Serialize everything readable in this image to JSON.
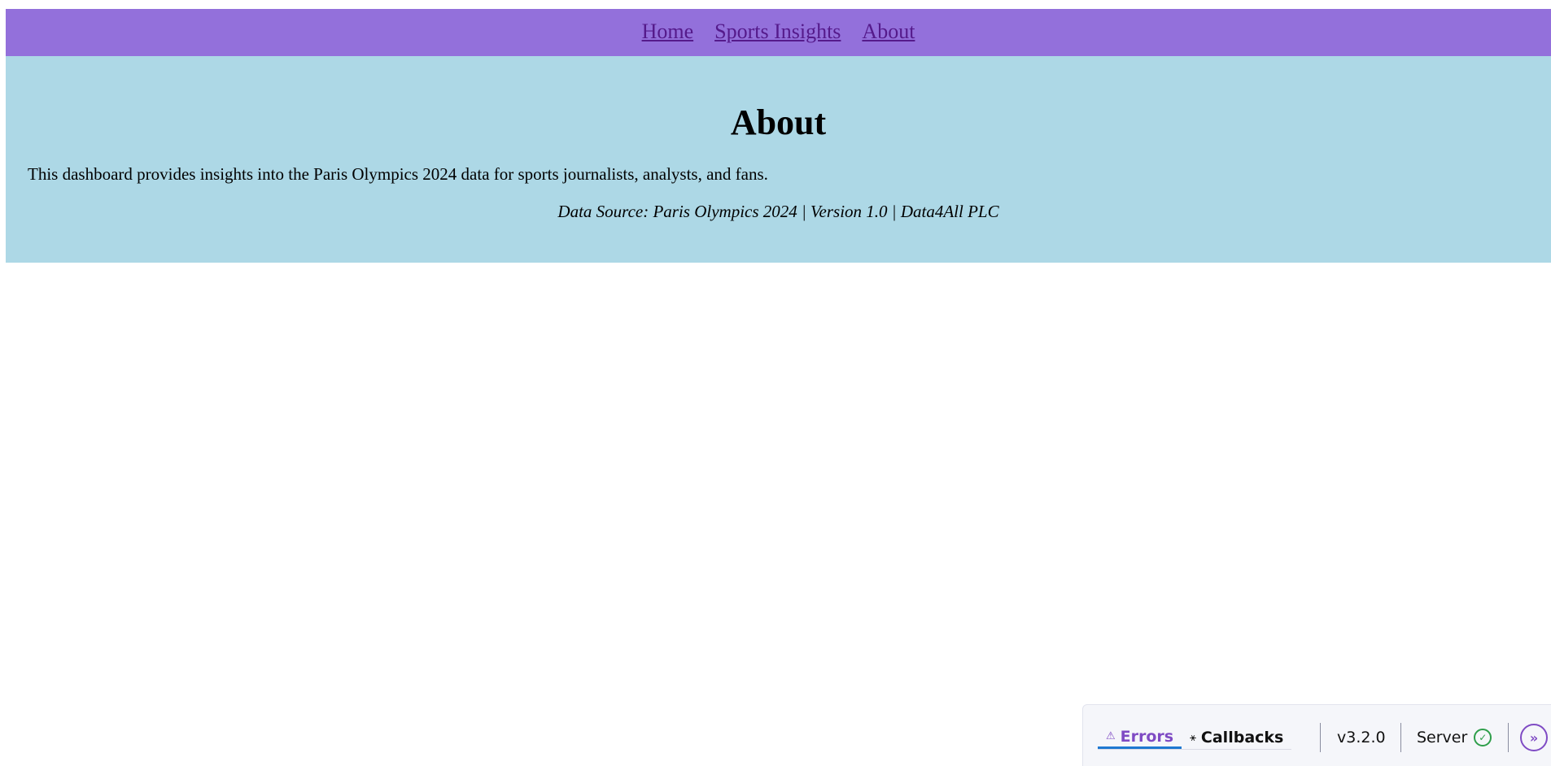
{
  "nav": {
    "links": [
      "Home",
      "Sports Insights",
      "About"
    ]
  },
  "about": {
    "title": "About",
    "description": "This dashboard provides insights into the Paris Olympics 2024 data for sports journalists, analysts, and fans.",
    "source": "Data Source: Paris Olympics 2024 | Version 1.0 | Data4All PLC"
  },
  "devtools": {
    "errors_label": "Errors",
    "callbacks_label": "Callbacks",
    "version": "v3.2.0",
    "server_label": "Server",
    "errors_icon": "warning-icon",
    "callbacks_icon": "callback-graph-icon",
    "server_status_icon": "check-circle-icon",
    "expand_icon": "expand-icon"
  },
  "colors": {
    "navbar_bg": "#9370db",
    "panel_bg": "#add8e6",
    "link": "#551a8b",
    "devtools_accent": "#7f4bc4",
    "server_ok": "#2e9e4a"
  }
}
